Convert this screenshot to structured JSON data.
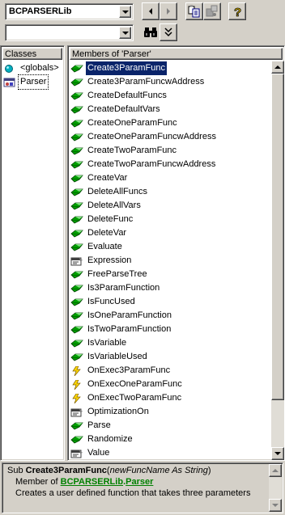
{
  "toolbar": {
    "library_value": "BCPARSERLib",
    "search_value": ""
  },
  "classes": {
    "header": "Classes",
    "items": [
      {
        "label": "<globals>",
        "icon": "globals-icon"
      },
      {
        "label": "Parser",
        "icon": "class-icon"
      }
    ]
  },
  "members": {
    "header": "Members of 'Parser'",
    "selected_index": 0,
    "items": [
      {
        "label": "Create3ParamFunc",
        "icon": "method-icon"
      },
      {
        "label": "Create3ParamFuncwAddress",
        "icon": "method-icon"
      },
      {
        "label": "CreateDefaultFuncs",
        "icon": "method-icon"
      },
      {
        "label": "CreateDefaultVars",
        "icon": "method-icon"
      },
      {
        "label": "CreateOneParamFunc",
        "icon": "method-icon"
      },
      {
        "label": "CreateOneParamFuncwAddress",
        "icon": "method-icon"
      },
      {
        "label": "CreateTwoParamFunc",
        "icon": "method-icon"
      },
      {
        "label": "CreateTwoParamFuncwAddress",
        "icon": "method-icon"
      },
      {
        "label": "CreateVar",
        "icon": "method-icon"
      },
      {
        "label": "DeleteAllFuncs",
        "icon": "method-icon"
      },
      {
        "label": "DeleteAllVars",
        "icon": "method-icon"
      },
      {
        "label": "DeleteFunc",
        "icon": "method-icon"
      },
      {
        "label": "DeleteVar",
        "icon": "method-icon"
      },
      {
        "label": "Evaluate",
        "icon": "method-icon"
      },
      {
        "label": "Expression",
        "icon": "property-icon"
      },
      {
        "label": "FreeParseTree",
        "icon": "method-icon"
      },
      {
        "label": "Is3ParamFunction",
        "icon": "method-icon"
      },
      {
        "label": "IsFuncUsed",
        "icon": "method-icon"
      },
      {
        "label": "IsOneParamFunction",
        "icon": "method-icon"
      },
      {
        "label": "IsTwoParamFunction",
        "icon": "method-icon"
      },
      {
        "label": "IsVariable",
        "icon": "method-icon"
      },
      {
        "label": "IsVariableUsed",
        "icon": "method-icon"
      },
      {
        "label": "OnExec3ParamFunc",
        "icon": "event-icon"
      },
      {
        "label": "OnExecOneParamFunc",
        "icon": "event-icon"
      },
      {
        "label": "OnExecTwoParamFunc",
        "icon": "event-icon"
      },
      {
        "label": "OptimizationOn",
        "icon": "property-icon"
      },
      {
        "label": "Parse",
        "icon": "method-icon"
      },
      {
        "label": "Randomize",
        "icon": "method-icon"
      },
      {
        "label": "Value",
        "icon": "property-icon"
      }
    ]
  },
  "description": {
    "sub_keyword": "Sub ",
    "func_name": "Create3ParamFunc",
    "open_paren": "(",
    "param": "newFuncName As String",
    "close_paren": ")",
    "member_of": "Member of ",
    "lib_link": "BCPARSERLib",
    "dot": ".",
    "class_link": "Parser",
    "summary": "Creates a user defined function that takes three parameters"
  }
}
